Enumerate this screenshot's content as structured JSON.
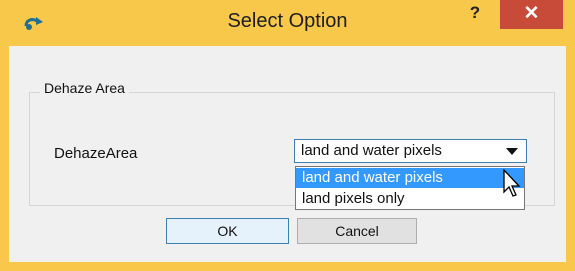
{
  "dialog": {
    "title": "Select Option",
    "help_label": "?",
    "close_label": "✕",
    "group_title": "Dehaze Area",
    "field_label": "DehazeArea",
    "select": {
      "selected_value": "land and water pixels",
      "options": [
        "land and water pixels",
        "land pixels only"
      ]
    },
    "ok_label": "OK",
    "cancel_label": "Cancel"
  },
  "colors": {
    "titlebar": "#f8c84a",
    "close_button": "#c84b3a",
    "selection": "#3399ff",
    "app_icon": "#1f6f94"
  }
}
